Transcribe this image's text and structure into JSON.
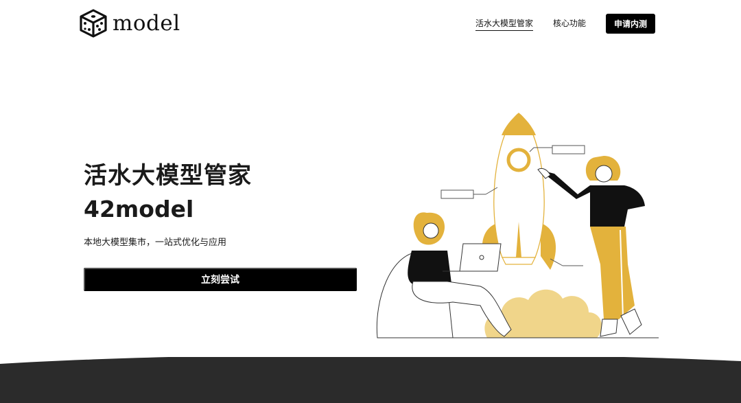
{
  "brand": {
    "logo_text": "model"
  },
  "nav": {
    "items": [
      {
        "label": "活水大模型管家",
        "active": true
      },
      {
        "label": "核心功能",
        "active": false
      }
    ],
    "cta_label": "申请内测"
  },
  "hero": {
    "title": "活水大模型管家",
    "brand": "42model",
    "subtitle": "本地大模型集市，一站式优化与应用",
    "cta_label": "立刻尝试"
  },
  "colors": {
    "accent": "#E3B23C",
    "accent_light": "#F0D58A",
    "dark": "#000000",
    "footer": "#2B2B2B"
  }
}
